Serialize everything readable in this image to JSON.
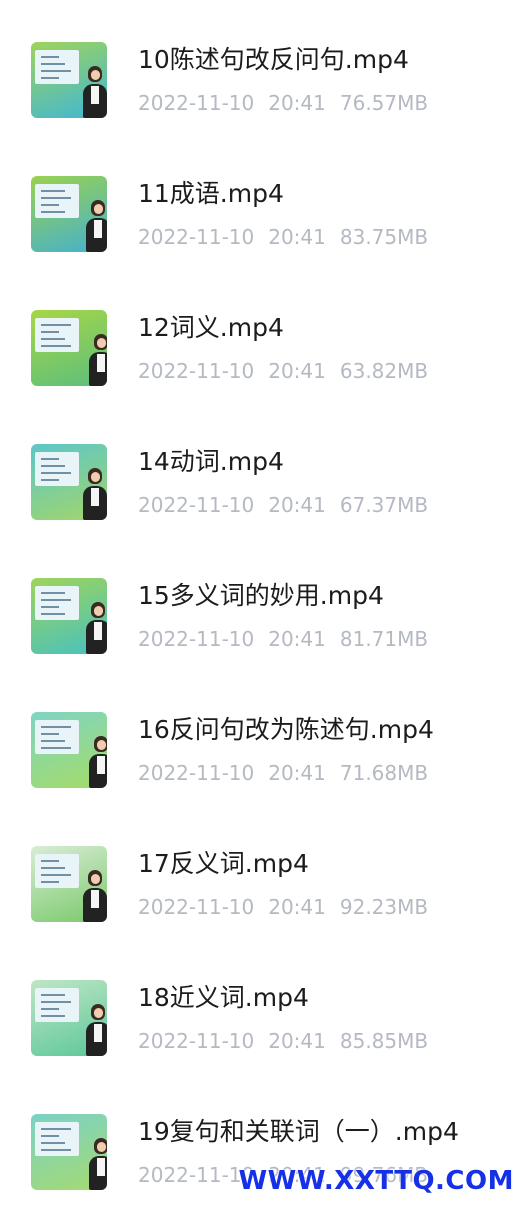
{
  "files": [
    {
      "name": "10陈述句改反问句.mp4",
      "date": "2022-11-10",
      "time": "20:41",
      "size": "76.57MB",
      "thumb_bg": [
        "#9fd45a",
        "#3fb6d6"
      ]
    },
    {
      "name": "11成语.mp4",
      "date": "2022-11-10",
      "time": "20:41",
      "size": "83.75MB",
      "thumb_bg": [
        "#9ad24e",
        "#44b0cf"
      ]
    },
    {
      "name": "12词义.mp4",
      "date": "2022-11-10",
      "time": "20:41",
      "size": "63.82MB",
      "thumb_bg": [
        "#a8d646",
        "#5bbf7d"
      ]
    },
    {
      "name": "14动词.mp4",
      "date": "2022-11-10",
      "time": "20:41",
      "size": "67.37MB",
      "thumb_bg": [
        "#5cc6c9",
        "#a2d66a"
      ]
    },
    {
      "name": "15多义词的妙用.mp4",
      "date": "2022-11-10",
      "time": "20:41",
      "size": "81.71MB",
      "thumb_bg": [
        "#9fd45a",
        "#46c1c0"
      ]
    },
    {
      "name": "16反问句改为陈述句.mp4",
      "date": "2022-11-10",
      "time": "20:41",
      "size": "71.68MB",
      "thumb_bg": [
        "#7fd4c4",
        "#a4dc66"
      ]
    },
    {
      "name": "17反义词.mp4",
      "date": "2022-11-10",
      "time": "20:41",
      "size": "92.23MB",
      "thumb_bg": [
        "#d8ecd6",
        "#7ac96a"
      ]
    },
    {
      "name": "18近义词.mp4",
      "date": "2022-11-10",
      "time": "20:41",
      "size": "85.85MB",
      "thumb_bg": [
        "#bfe6c5",
        "#5cc79a"
      ]
    },
    {
      "name": "19复句和关联词（一）.mp4",
      "date": "2022-11-10",
      "time": "20:41",
      "size": "99.76MB",
      "thumb_bg": [
        "#7ad2c6",
        "#a5da72"
      ]
    }
  ],
  "watermark": "WWW.XXTTQ.COM",
  "colors": {
    "name_text": "#1c1c1c",
    "meta_text": "#b4b9c2",
    "watermark": "#1530e6"
  },
  "icons": {
    "thumbnail": "video-thumbnail-teacher-icon"
  }
}
